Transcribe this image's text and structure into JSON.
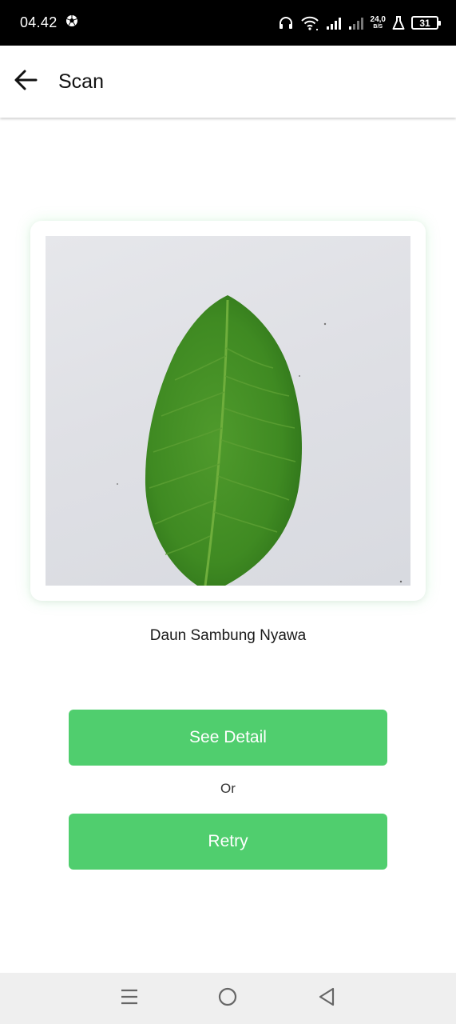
{
  "status_bar": {
    "time": "04.42",
    "net_speed_value": "24,0",
    "net_speed_unit": "B/S",
    "battery_level": "31",
    "icons": [
      "soccer-ball-icon",
      "headphones-icon",
      "wifi-icon",
      "signal-icon",
      "signal-weak-icon",
      "flask-icon",
      "battery-icon"
    ]
  },
  "app_bar": {
    "title": "Scan",
    "back_icon": "arrow-left-icon"
  },
  "scan_result": {
    "image": "leaf-photo",
    "plant_name": "Daun Sambung Nyawa"
  },
  "actions": {
    "see_detail_label": "See Detail",
    "or_label": "Or",
    "retry_label": "Retry"
  },
  "colors": {
    "accent_green": "#50ce6e",
    "status_bar_bg": "#000000",
    "nav_bar_bg": "#efefef"
  },
  "nav_bar": {
    "icons": [
      "menu-icon",
      "home-circle-icon",
      "back-triangle-icon"
    ]
  }
}
